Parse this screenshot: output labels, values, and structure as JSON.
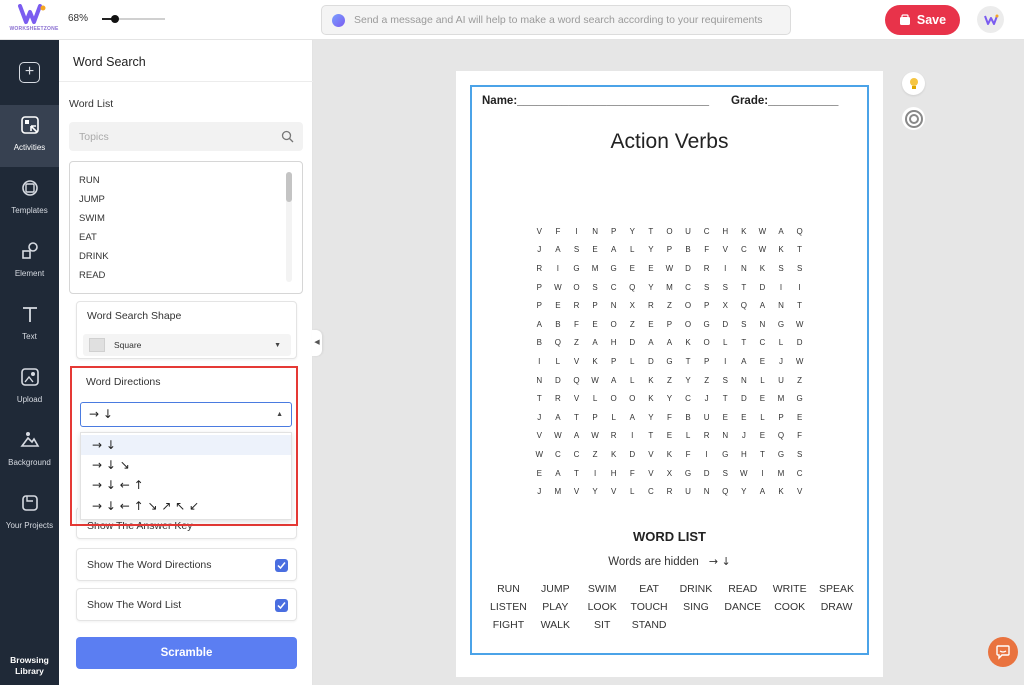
{
  "app": {
    "logo_text": "WORKSHEETZONE",
    "zoom": "68%",
    "zoom_value": 0.2
  },
  "ai_prompt": {
    "placeholder": "Send a message and AI will help to make a word search according to your requirements"
  },
  "toolbar": {
    "save_label": "Save"
  },
  "rail": {
    "items": [
      {
        "label": "Activities",
        "icon": "activities-icon",
        "active": true
      },
      {
        "label": "Templates",
        "icon": "templates-icon"
      },
      {
        "label": "Element",
        "icon": "element-icon"
      },
      {
        "label": "Text",
        "icon": "text-icon"
      },
      {
        "label": "Upload",
        "icon": "upload-icon"
      },
      {
        "label": "Background",
        "icon": "background-icon"
      },
      {
        "label": "Your Projects",
        "icon": "projects-icon"
      }
    ],
    "bottom_label": "Browsing Library"
  },
  "panel": {
    "title": "Word Search",
    "word_list_label": "Word List",
    "topics_placeholder": "Topics",
    "words": [
      "RUN",
      "JUMP",
      "SWIM",
      "EAT",
      "DRINK",
      "READ"
    ],
    "shape_label": "Word Search Shape",
    "shape_value": "Square",
    "directions_label": "Word Directions",
    "directions_value": "→ ↓",
    "directions_options": [
      "→ ↓",
      "→ ↓ ↘",
      "→ ↓ ← ↑",
      "→ ↓ ← ↑ ↘ ↗ ↖ ↙"
    ],
    "answer_key_label": "Show The Answer Key",
    "show_directions_label": "Show The Word Directions",
    "show_word_list_label": "Show The Word List",
    "scramble_label": "Scramble"
  },
  "worksheet": {
    "name_line": "Name:______________________________",
    "grade_line": "Grade:___________",
    "title": "Action Verbs",
    "grid": [
      "VFINPYTOUCHKWAQ",
      "JASEALYPBFVCWKT",
      "RIGMGEEWDRINKSS",
      "PWOSCQYMCSSTDII",
      "PERPNXRZOPXQANT",
      "ABFEOZEPOGDSNGW",
      "BQZAHDAAKOLTCLD",
      "ILVKPLDGTPIAEJW",
      "NDQWALKZYZSNLUZ",
      "TRVLOOKYCJTDEMG",
      "JATPLAYFBUEELPE",
      "VWAWRITELRNJEQF",
      "WCCZKDVKFIGHTGS",
      "EATIHFVXGDSWIMC",
      "JMVYVLCRUNQYAKV"
    ],
    "word_list_title": "WORD LIST",
    "hidden_text": "Words are hidden",
    "hidden_dirs": "→ ↓",
    "words": [
      [
        "RUN",
        "JUMP",
        "SWIM",
        "EAT",
        "DRINK",
        "READ",
        "WRITE",
        "SPEAK"
      ],
      [
        "LISTEN",
        "PLAY",
        "LOOK",
        "TOUCH",
        "SING",
        "DANCE",
        "COOK",
        "DRAW"
      ],
      [
        "FIGHT",
        "WALK",
        "SIT",
        "STAND"
      ]
    ]
  },
  "colors": {
    "accent": "#5b7ef2",
    "save": "#e8334a",
    "frame": "#4ba3e8",
    "highlight": "#e53935",
    "rail": "#1f2937"
  }
}
